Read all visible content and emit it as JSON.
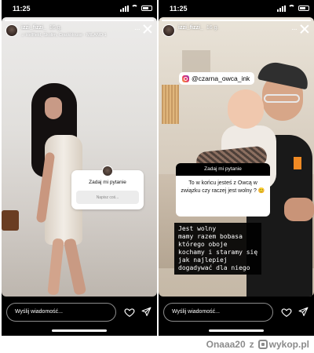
{
  "left_story": {
    "status_time": "11:25",
    "username": "izzi_fizzi_",
    "post_time": "16 g.",
    "music": "♫ Hellfield, Skolim, CrackHouse · MILANO 1",
    "question_title": "Zadaj mi pytanie",
    "question_placeholder": "Napisz coś...",
    "message_placeholder": "Wyślij wiadomość..."
  },
  "right_story": {
    "status_time": "11:25",
    "username": "izzi_fizzi_",
    "post_time": "16 g.",
    "mention": "@czarna_owca_ink",
    "question_title": "Zadaj mi pytanie",
    "question_text": "To w końcu jesteś z Owcą w związku czy raczej jest wolny ? 😊",
    "answer_lines": [
      "Jest wolny",
      "mamy razem bobasa",
      "którego oboje",
      "kochamy i staramy się",
      "jak najlepiej",
      "dogadywać dla niego"
    ],
    "message_placeholder": "Wyślij wiadomość..."
  },
  "watermark": {
    "author": "Onaaa20",
    "z": "z",
    "site": "wykop.pl"
  },
  "colors": {
    "background": "#000000",
    "text": "#ffffff",
    "watermark": "#8c8c8c"
  }
}
